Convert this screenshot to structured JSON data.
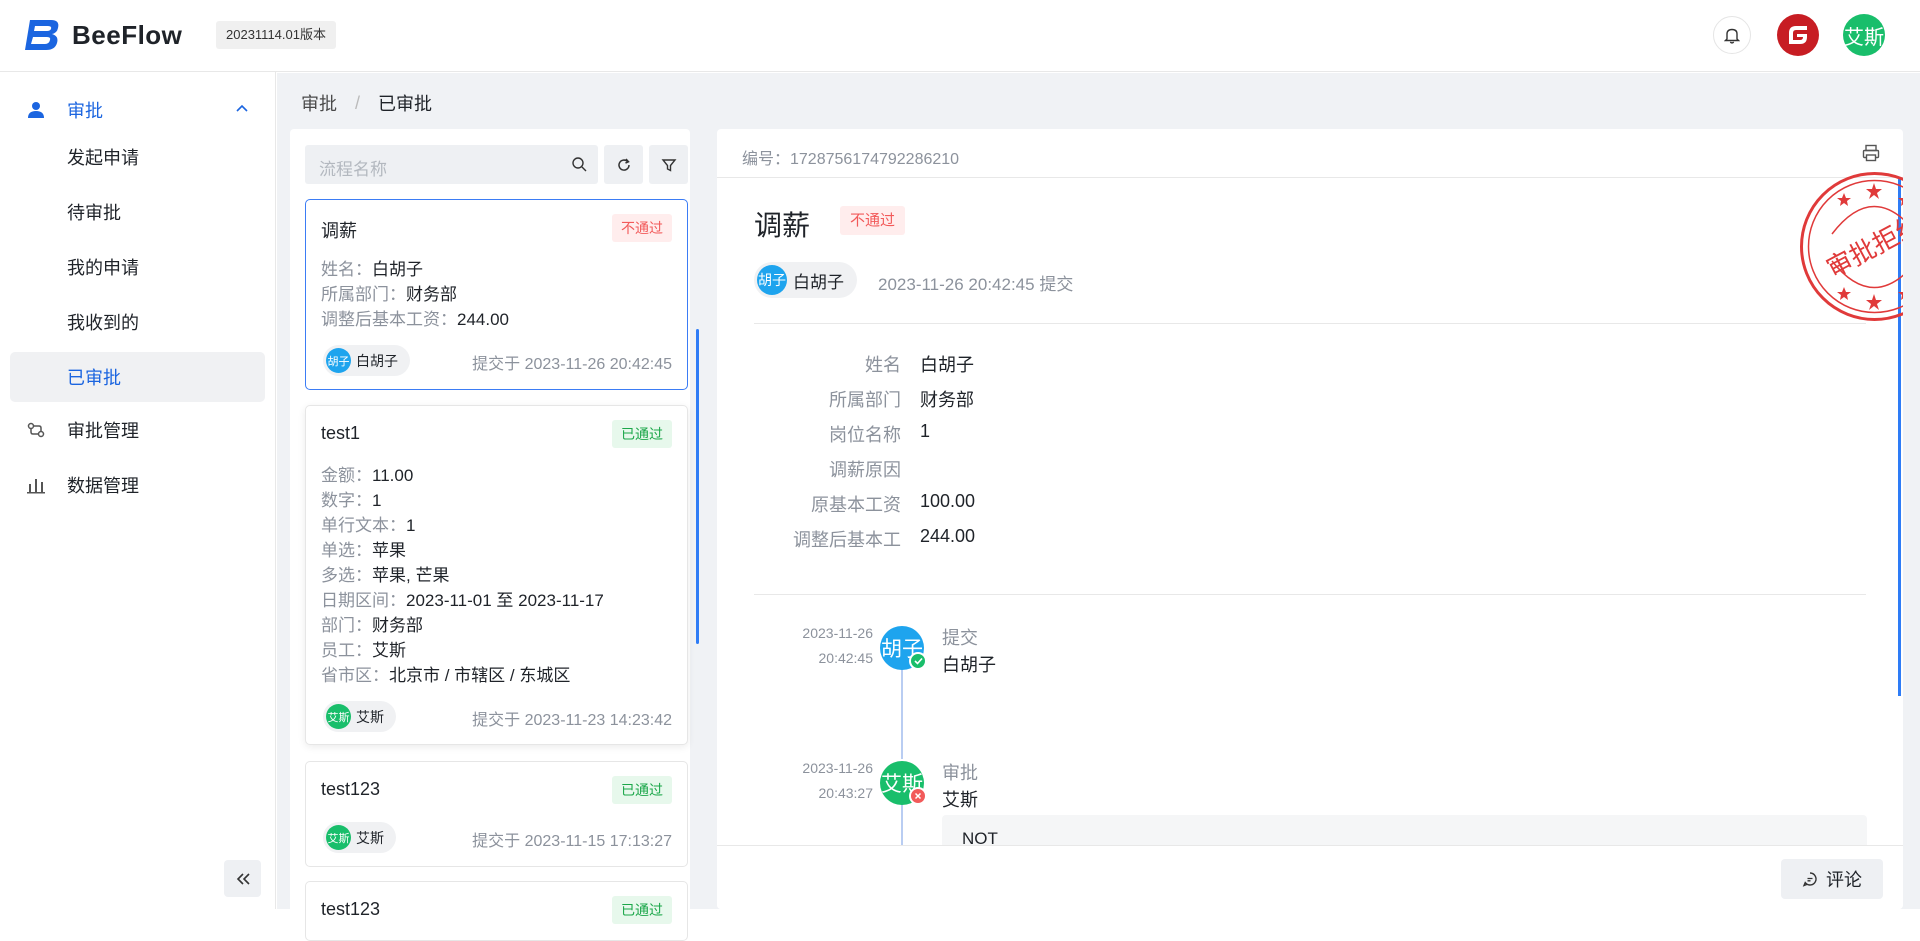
{
  "app": {
    "name": "BeeFlow",
    "version": "20231114.01版本",
    "user_avatar": "艾斯"
  },
  "colors": {
    "accent": "#1b65e0",
    "fail": "#f25a5a",
    "pass": "#1ca74a",
    "avatar_blue": "#1ea4ee",
    "avatar_green": "#19be6b"
  },
  "sidebar": {
    "group": "审批",
    "items": [
      "发起申请",
      "待审批",
      "我的申请",
      "我收到的",
      "已审批"
    ],
    "active": "已审批",
    "others": [
      "审批管理",
      "数据管理"
    ]
  },
  "breadcrumb": [
    "审批",
    "已审批"
  ],
  "list": {
    "search_placeholder": "流程名称",
    "cards": [
      {
        "title": "调薪",
        "status": "不通过",
        "fields": [
          {
            "k": "姓名：",
            "v": "白胡子"
          },
          {
            "k": "所属部门：",
            "v": "财务部"
          },
          {
            "k": "调整后基本工资：",
            "v": "244.00"
          }
        ],
        "avatar": "胡子",
        "name": "白胡子",
        "time": "提交于 2023-11-26 20:42:45"
      },
      {
        "title": "test1",
        "status": "已通过",
        "fields": [
          {
            "k": "金额：",
            "v": "11.00"
          },
          {
            "k": "数字：",
            "v": "1"
          },
          {
            "k": "单行文本：",
            "v": "1"
          },
          {
            "k": "单选：",
            "v": "苹果"
          },
          {
            "k": "多选：",
            "v": "苹果, 芒果"
          },
          {
            "k": "日期区间：",
            "v": "2023-11-01 至 2023-11-17"
          },
          {
            "k": "部门：",
            "v": "财务部"
          },
          {
            "k": "员工：",
            "v": "艾斯"
          },
          {
            "k": "省市区：",
            "v": "北京市 / 市辖区 / 东城区"
          }
        ],
        "avatar": "艾斯",
        "name": "艾斯",
        "time": "提交于 2023-11-23 14:23:42"
      },
      {
        "title": "test123",
        "status": "已通过",
        "fields": [],
        "avatar": "艾斯",
        "name": "艾斯",
        "time": "提交于 2023-11-15 17:13:27"
      },
      {
        "title": "test123",
        "status": "已通过"
      }
    ]
  },
  "detail": {
    "number": "编号：1728756174792286210",
    "title": "调薪",
    "status": "不通过",
    "submitter_avatar": "胡子",
    "submitter": "白胡子",
    "submit_time": "2023-11-26 20:42:45 提交",
    "fields": [
      {
        "k": "姓名",
        "v": "白胡子"
      },
      {
        "k": "所属部门",
        "v": "财务部"
      },
      {
        "k": "岗位名称",
        "v": "1"
      },
      {
        "k": "调薪原因",
        "v": ""
      },
      {
        "k": "原基本工资",
        "v": "100.00"
      },
      {
        "k": "调整后基本工",
        "v": "244.00"
      }
    ],
    "timeline": [
      {
        "date": "2023-11-26",
        "time": "20:42:45",
        "avatar": "胡子",
        "action": "提交",
        "name": "白胡子",
        "result": "approved"
      },
      {
        "date": "2023-11-26",
        "time": "20:43:27",
        "avatar": "艾斯",
        "action": "审批",
        "name": "艾斯",
        "result": "rejected",
        "comment": "NOT"
      }
    ],
    "stamp_text": "审批拒绝",
    "comment_button": "评论"
  }
}
